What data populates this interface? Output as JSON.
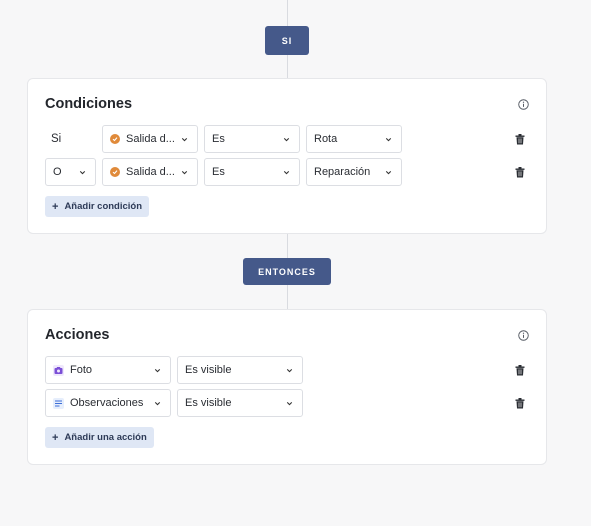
{
  "flow": {
    "if_label": "SI",
    "then_label": "ENTONCES"
  },
  "conditions": {
    "title": "Condiciones",
    "rows": [
      {
        "connector": "Si",
        "field": "Salida d...",
        "operator": "Es",
        "value": "Rota"
      },
      {
        "connector": "O",
        "field": "Salida d...",
        "operator": "Es",
        "value": "Reparación"
      }
    ],
    "add_label": "Añadir condición"
  },
  "actions": {
    "title": "Acciones",
    "rows": [
      {
        "field": "Foto",
        "field_icon": "photo-icon",
        "state": "Es visible"
      },
      {
        "field": "Observaciones",
        "field_icon": "text-lines-icon",
        "state": "Es visible"
      }
    ],
    "add_label": "Añadir una acción"
  },
  "colors": {
    "primary_pill": "#45598a",
    "add_button_bg": "#dfe7f5",
    "status_dot": "#e08a3a",
    "photo_icon": "#7b4fd6",
    "text_icon": "#3e6fd8"
  }
}
